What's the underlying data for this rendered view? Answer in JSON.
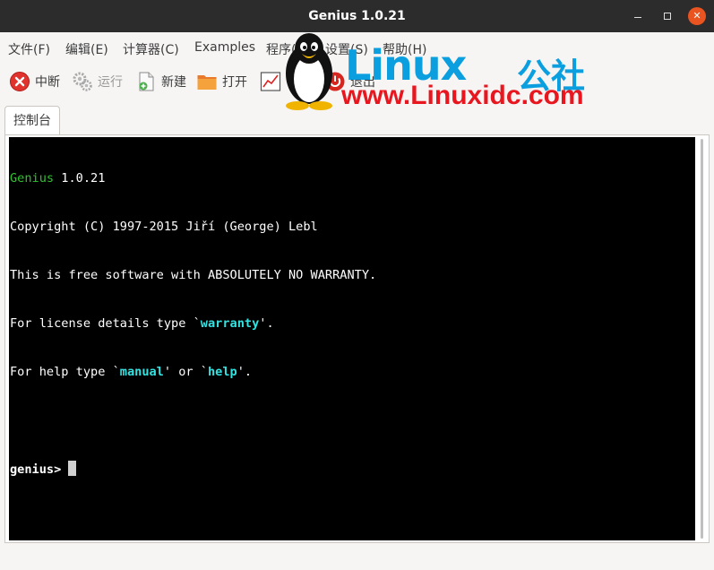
{
  "window": {
    "title": "Genius 1.0.21",
    "controls": {
      "minimize": "–",
      "maximize": "□",
      "close": "✕"
    }
  },
  "menubar": {
    "items": [
      {
        "label": "文件(F)"
      },
      {
        "label": "编辑(E)"
      },
      {
        "label": "计算器(C)"
      },
      {
        "label": "Examples"
      },
      {
        "label": "程序("
      },
      {
        "label": "设置(S)"
      },
      {
        "label": "帮助(H)"
      }
    ]
  },
  "toolbar": {
    "interrupt": {
      "label": "中断",
      "icon": "stop-circle-icon"
    },
    "run": {
      "label": "运行",
      "icon": "gears-icon"
    },
    "new": {
      "label": "新建",
      "icon": "new-file-icon"
    },
    "open": {
      "label": "打开",
      "icon": "folder-icon"
    },
    "plot": {
      "label": "",
      "icon": "plot-icon"
    },
    "quit": {
      "label": "退出",
      "icon": "power-icon"
    }
  },
  "tabs": [
    {
      "label": "控制台"
    }
  ],
  "console": {
    "line1_name": "Genius",
    "line1_version": " 1.0.21",
    "line2": "Copyright (C) 1997-2015 Jiří (George) Lebl",
    "line3": "This is free software with ABSOLUTELY NO WARRANTY.",
    "line4_pre": "For license details type `",
    "line4_cmd": "warranty",
    "line4_post": "'.",
    "line5_pre": "For help type `",
    "line5_cmd1": "manual",
    "line5_mid": "' or `",
    "line5_cmd2": "help",
    "line5_post": "'.",
    "prompt": "genius> "
  },
  "watermark": {
    "brand": "Linux",
    "suffix": "公社",
    "url": "www.Linuxidc.com"
  },
  "colors": {
    "titlebar": "#2c2c2c",
    "close_button": "#e95420",
    "console_bg": "#000000",
    "console_green": "#2ec22e",
    "console_cyan": "#34e2e2",
    "watermark_blue": "#0b9fe0",
    "watermark_red": "#e8161f"
  }
}
